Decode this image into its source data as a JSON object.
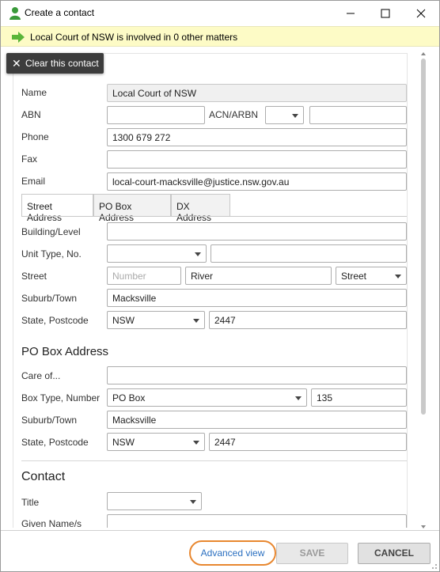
{
  "window": {
    "title": "Create a contact"
  },
  "banner": {
    "text": "Local Court of NSW is involved in 0 other matters"
  },
  "clear_button": {
    "label": "Clear this contact"
  },
  "contact_fields": {
    "name": {
      "label": "Name",
      "value": "Local Court of NSW"
    },
    "abn": {
      "label": "ABN",
      "value": ""
    },
    "acn": {
      "label": "ACN/ARBN",
      "value": "",
      "type_value": ""
    },
    "phone": {
      "label": "Phone",
      "value": "1300 679 272"
    },
    "fax": {
      "label": "Fax",
      "value": ""
    },
    "email": {
      "label": "Email",
      "value": "local-court-macksville@justice.nsw.gov.au"
    }
  },
  "tabs": [
    {
      "label": "Street Address",
      "active": true
    },
    {
      "label": "PO Box Address",
      "active": false
    },
    {
      "label": "DX Address",
      "active": false
    }
  ],
  "street_address": {
    "building": {
      "label": "Building/Level",
      "value": ""
    },
    "unit": {
      "label": "Unit Type, No.",
      "type_value": "",
      "number_value": ""
    },
    "street": {
      "label": "Street",
      "number_placeholder": "Number",
      "name_value": "River",
      "type_value": "Street"
    },
    "suburb": {
      "label": "Suburb/Town",
      "value": "Macksville"
    },
    "state": {
      "label": "State, Postcode",
      "state_value": "NSW",
      "postcode_value": "2447"
    }
  },
  "po_box_section": {
    "title": "PO Box Address",
    "care_of": {
      "label": "Care of...",
      "value": ""
    },
    "box": {
      "label": "Box Type, Number",
      "type_value": "PO Box",
      "number_value": "135"
    },
    "suburb": {
      "label": "Suburb/Town",
      "value": "Macksville"
    },
    "state": {
      "label": "State, Postcode",
      "state_value": "NSW",
      "postcode_value": "2447"
    }
  },
  "contact_section": {
    "title": "Contact",
    "title_field": {
      "label": "Title",
      "value": ""
    },
    "given_names": {
      "label": "Given Name/s"
    }
  },
  "footer": {
    "advanced_view": "Advanced view",
    "save": "SAVE",
    "cancel": "CANCEL"
  },
  "colors": {
    "banner_bg": "#fdfbc6",
    "arrow_green": "#5ab53a",
    "user_icon_green": "#3a9a3a",
    "highlight_orange": "#e8872f",
    "link_blue": "#2a6fc0"
  }
}
